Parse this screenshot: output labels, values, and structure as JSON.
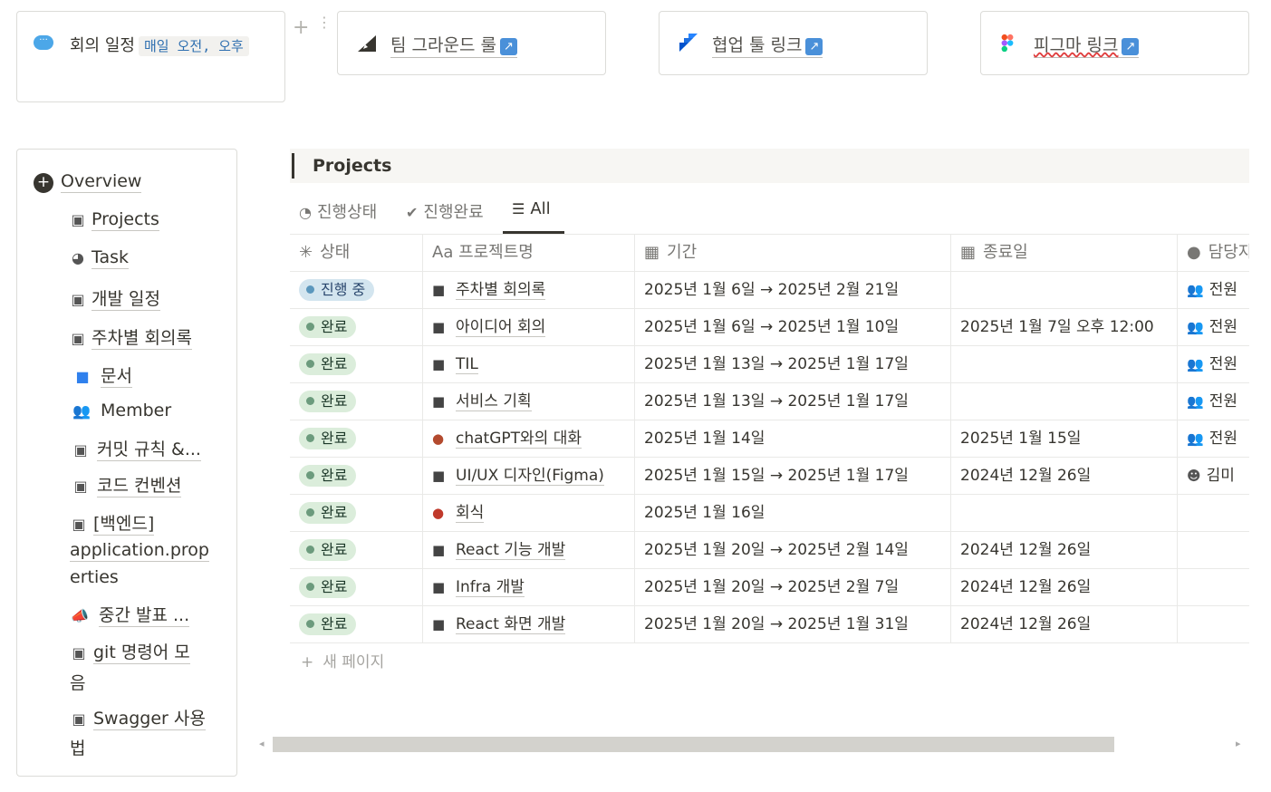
{
  "callout": {
    "text": "회의 일정",
    "code": "매일 오전, 오후"
  },
  "link_cards": [
    {
      "label": "팀 그라운드 룰",
      "icon": "ground-rule-icon"
    },
    {
      "label": "협업 툴 링크",
      "icon": "jira-icon"
    },
    {
      "label": "피그마 링크",
      "icon": "figma-icon"
    }
  ],
  "toc": {
    "items": [
      {
        "label": "Overview",
        "icon": "plus-circle-icon"
      },
      {
        "label": "Projects",
        "icon": "link-page-icon"
      },
      {
        "label": "Task",
        "icon": "task-icon"
      },
      {
        "label": "개발 일정",
        "icon": "link-page-icon"
      },
      {
        "label": "주차별 회의록",
        "icon": "link-page-icon"
      },
      {
        "label": "문서",
        "icon": "folder-icon"
      },
      {
        "label": "Member",
        "icon": "people-icon"
      },
      {
        "label": "커밋 규칙 &...",
        "icon": "link-page-icon"
      },
      {
        "label": "코드 컨벤션",
        "icon": "link-page-icon"
      },
      {
        "label": "[백엔드]",
        "icon": "link-page-icon"
      },
      {
        "label": "application.prop",
        "icon": ""
      },
      {
        "label": "erties",
        "icon": ""
      },
      {
        "label": "중간 발표 ...",
        "icon": "megaphone-icon"
      },
      {
        "label": "git 명령어 모",
        "icon": "link-page-icon"
      },
      {
        "label": "음",
        "icon": ""
      },
      {
        "label": "Swagger 사용",
        "icon": "link-page-icon"
      },
      {
        "label": "법",
        "icon": ""
      }
    ]
  },
  "database": {
    "title": "Projects",
    "tabs": [
      {
        "label": "진행상태",
        "icon": "progress-icon"
      },
      {
        "label": "진행완료",
        "icon": "check-badge-icon"
      },
      {
        "label": "All",
        "icon": "list-icon",
        "active": true
      }
    ],
    "columns": [
      "상태",
      "Aa 프로젝트명",
      "기간",
      "종료일",
      "담당자"
    ],
    "rows": [
      {
        "status": "진행 중",
        "status_type": "progress",
        "name": "주차별 회의록",
        "period": "2025년 1월 6일 → 2025년 2월 21일",
        "end": "",
        "owner": "전원"
      },
      {
        "status": "완료",
        "status_type": "done",
        "name": "아이디어 회의",
        "period": "2025년 1월 6일 → 2025년 1월 10일",
        "end": "2025년 1월 7일 오후 12:00",
        "owner": "전원"
      },
      {
        "status": "완료",
        "status_type": "done",
        "name": "TIL",
        "period": "2025년 1월 13일 → 2025년 1월 17일",
        "end": "",
        "owner": "전원"
      },
      {
        "status": "완료",
        "status_type": "done",
        "name": "서비스 기획",
        "period": "2025년 1월 13일 → 2025년 1월 17일",
        "end": "",
        "owner": "전원"
      },
      {
        "status": "완료",
        "status_type": "done",
        "name": "chatGPT와의 대화",
        "period": "2025년 1월 14일",
        "end": "2025년 1월 15일",
        "owner": "전원"
      },
      {
        "status": "완료",
        "status_type": "done",
        "name": "UI/UX 디자인(Figma)",
        "period": "2025년 1월 15일 → 2025년 1월 17일",
        "end": "2024년 12월 26일",
        "owner": "김미"
      },
      {
        "status": "완료",
        "status_type": "done",
        "name": "회식",
        "period": "2025년 1월 16일",
        "end": "",
        "owner": ""
      },
      {
        "status": "완료",
        "status_type": "done",
        "name": "React 기능 개발",
        "period": "2025년 1월 20일 → 2025년 2월 14일",
        "end": "2024년 12월 26일",
        "owner": ""
      },
      {
        "status": "완료",
        "status_type": "done",
        "name": "Infra 개발",
        "period": "2025년 1월 20일 → 2025년 2월 7일",
        "end": "2024년 12월 26일",
        "owner": ""
      },
      {
        "status": "완료",
        "status_type": "done",
        "name": "React 화면 개발",
        "period": "2025년 1월 20일 → 2025년 1월 31일",
        "end": "2024년 12월 26일",
        "owner": ""
      }
    ],
    "new_page_label": "새 페이지"
  }
}
